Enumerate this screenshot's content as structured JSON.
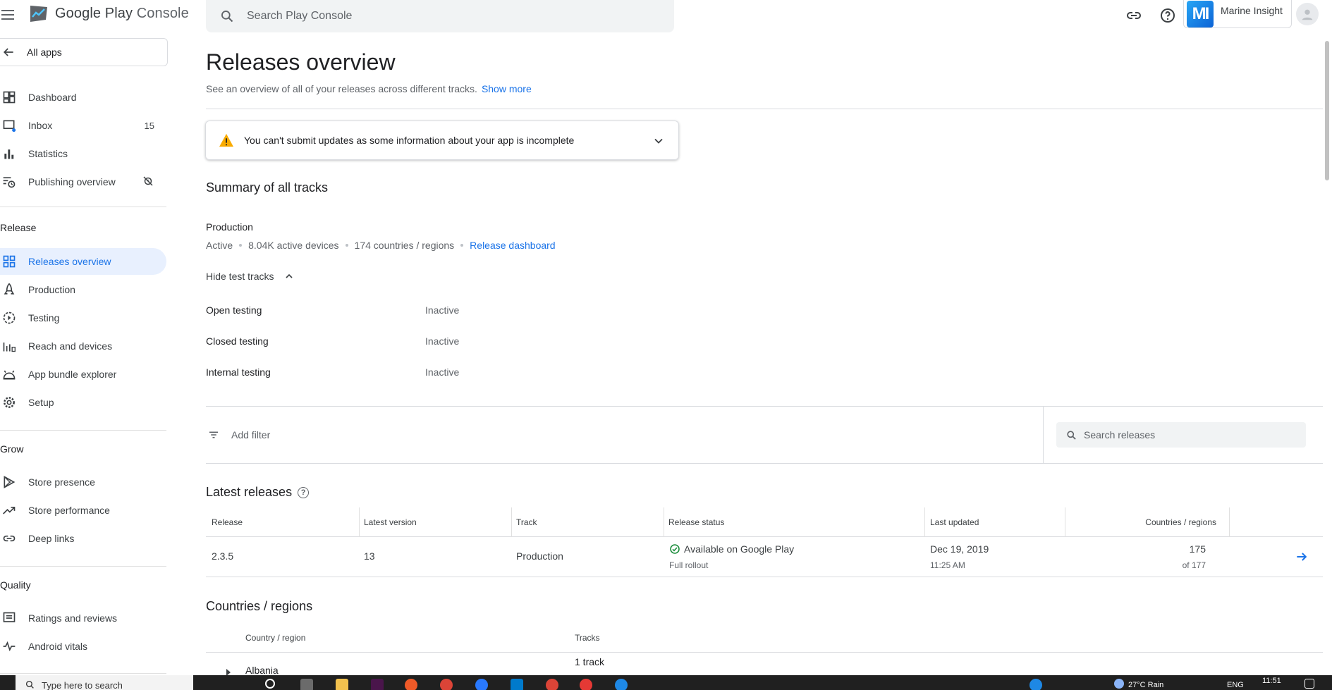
{
  "app": {
    "logo_text_1": "Google Play",
    "logo_text_2": "Console"
  },
  "search": {
    "placeholder": "Search Play Console"
  },
  "account": {
    "initials": "MI",
    "name": "Marine Insight"
  },
  "sidebar": {
    "all_apps": "All apps",
    "top_items": [
      {
        "label": "Dashboard"
      },
      {
        "label": "Inbox",
        "count": "15"
      },
      {
        "label": "Statistics"
      },
      {
        "label": "Publishing overview"
      }
    ],
    "release_section": "Release",
    "release_items": [
      {
        "label": "Releases overview"
      },
      {
        "label": "Production"
      },
      {
        "label": "Testing"
      },
      {
        "label": "Reach and devices"
      },
      {
        "label": "App bundle explorer"
      },
      {
        "label": "Setup"
      }
    ],
    "grow_section": "Grow",
    "grow_items": [
      {
        "label": "Store presence"
      },
      {
        "label": "Store performance"
      },
      {
        "label": "Deep links"
      }
    ],
    "quality_section": "Quality",
    "quality_items": [
      {
        "label": "Ratings and reviews"
      },
      {
        "label": "Android vitals"
      }
    ]
  },
  "main": {
    "title": "Releases overview",
    "subtitle": "See an overview of all of your releases across different tracks.",
    "show_more": "Show more",
    "warning": "You can't submit updates as some information about your app is incomplete",
    "summary_title": "Summary of all tracks",
    "production": {
      "label": "Production",
      "status": "Active",
      "devices": "8.04K active devices",
      "countries": "174 countries / regions",
      "link": "Release dashboard"
    },
    "hide_tests": "Hide test tracks",
    "tracks": [
      {
        "name": "Open testing",
        "status": "Inactive"
      },
      {
        "name": "Closed testing",
        "status": "Inactive"
      },
      {
        "name": "Internal testing",
        "status": "Inactive"
      }
    ],
    "add_filter": "Add filter",
    "search_releases_placeholder": "Search releases",
    "latest_title": "Latest releases",
    "table_headers": {
      "release": "Release",
      "version": "Latest version",
      "track": "Track",
      "status": "Release status",
      "updated": "Last updated",
      "countries": "Countries / regions"
    },
    "release_row": {
      "release": "2.3.5",
      "version": "13",
      "track": "Production",
      "status": "Available on Google Play",
      "status_sub": "Full rollout",
      "updated": "Dec 19, 2019",
      "updated_time": "11:25 AM",
      "countries": "175",
      "countries_sub": "of 177"
    },
    "countries_title": "Countries / regions",
    "country_headers": {
      "country": "Country / region",
      "tracks": "Tracks"
    },
    "country_row": {
      "country": "Albania",
      "tracks": "1 track"
    }
  },
  "taskbar": {
    "search": "Type here to search",
    "weather": "27°C  Rain",
    "lang": "ENG",
    "time": "11:51"
  },
  "colors": {
    "accent": "#1a73e8",
    "warning": "#f9ab00",
    "success": "#1e8e3e",
    "active_nav_bg": "#e8f0fe"
  }
}
